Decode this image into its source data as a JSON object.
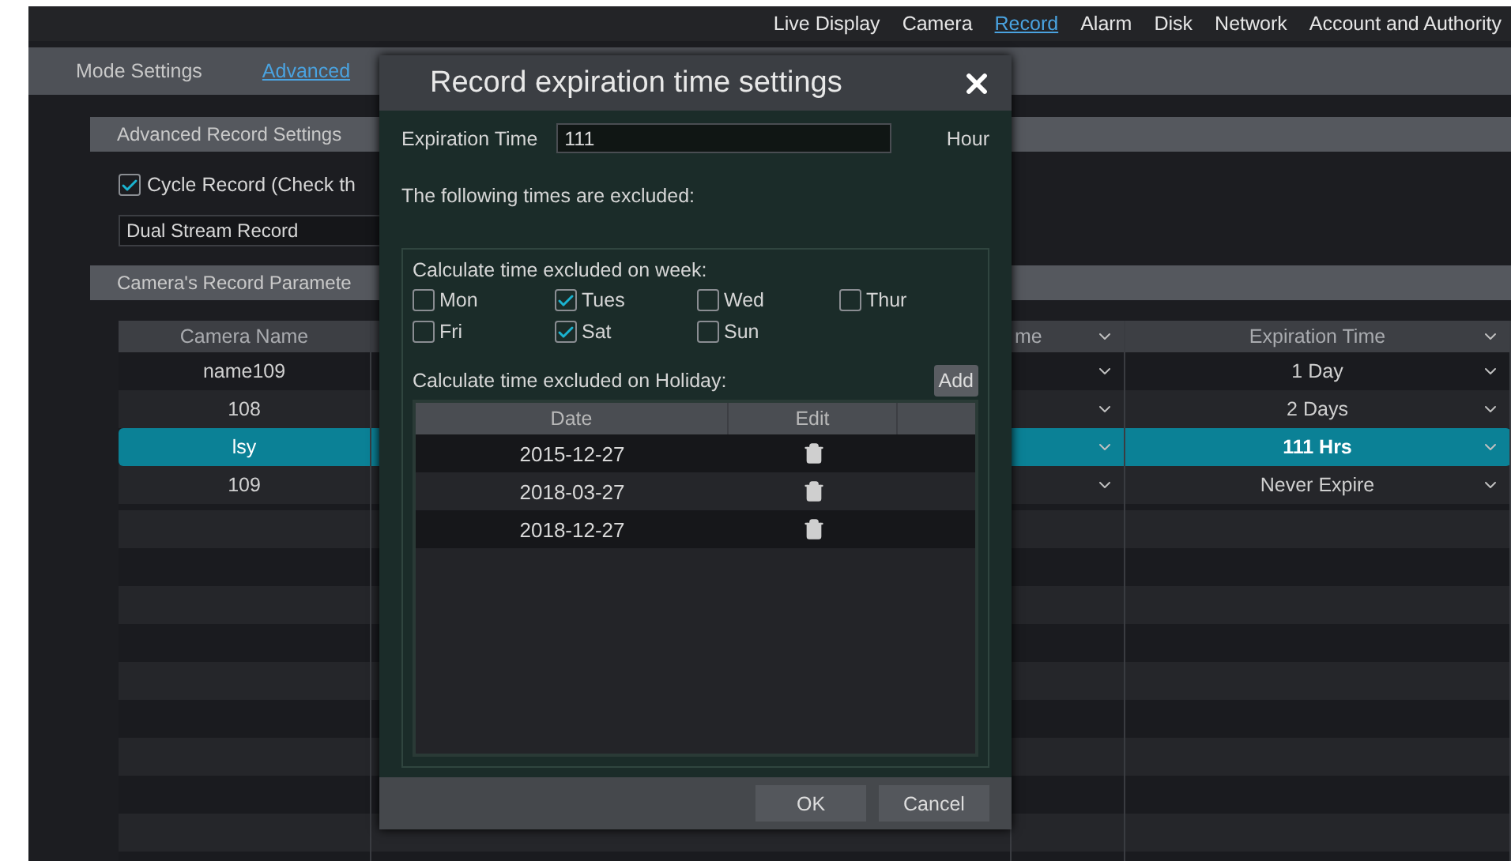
{
  "nav": [
    {
      "label": "Live Display",
      "selected": false
    },
    {
      "label": "Camera",
      "selected": false
    },
    {
      "label": "Record",
      "selected": true
    },
    {
      "label": "Alarm",
      "selected": false
    },
    {
      "label": "Disk",
      "selected": false
    },
    {
      "label": "Network",
      "selected": false
    },
    {
      "label": "Account and Authority",
      "selected": false
    }
  ],
  "subtabs": [
    {
      "label": "Mode Settings",
      "selected": false
    },
    {
      "label": "Advanced",
      "selected": true
    }
  ],
  "advanced_section": {
    "title": "Advanced Record Settings",
    "cycle_record": {
      "label": "Cycle Record (Check th",
      "checked": true
    },
    "stream_select": {
      "value": "Dual Stream Record"
    }
  },
  "camera_section": {
    "title": "Camera's Record Paramete",
    "table": {
      "columns": [
        {
          "label": "Camera Name",
          "dropdown": false
        },
        {
          "label": "me",
          "dropdown": true
        },
        {
          "label": "Expiration Time",
          "dropdown": true
        }
      ],
      "rows": [
        {
          "camera": "name109",
          "expiration": "1 Day",
          "selected": false
        },
        {
          "camera": "108",
          "expiration": "2 Days",
          "selected": false
        },
        {
          "camera": "lsy",
          "expiration": "111 Hrs",
          "selected": true
        },
        {
          "camera": "109",
          "expiration": "Never Expire",
          "selected": false
        }
      ]
    }
  },
  "dialog": {
    "title": "Record expiration time settings",
    "expiration": {
      "label": "Expiration Time",
      "value": "111",
      "unit": "Hour"
    },
    "note": "The following times are excluded:",
    "week": {
      "title": "Calculate time excluded on week:",
      "days": [
        {
          "label": "Mon",
          "checked": false
        },
        {
          "label": "Tues",
          "checked": true
        },
        {
          "label": "Wed",
          "checked": false
        },
        {
          "label": "Thur",
          "checked": false
        },
        {
          "label": "Fri",
          "checked": false
        },
        {
          "label": "Sat",
          "checked": true
        },
        {
          "label": "Sun",
          "checked": false
        }
      ]
    },
    "holiday": {
      "title": "Calculate time excluded on Holiday:",
      "add_button": "Add",
      "columns": [
        "Date",
        "Edit"
      ],
      "rows": [
        {
          "date": "2015-12-27"
        },
        {
          "date": "2018-03-27"
        },
        {
          "date": "2018-12-27"
        }
      ]
    },
    "buttons": [
      "OK",
      "Cancel"
    ]
  }
}
